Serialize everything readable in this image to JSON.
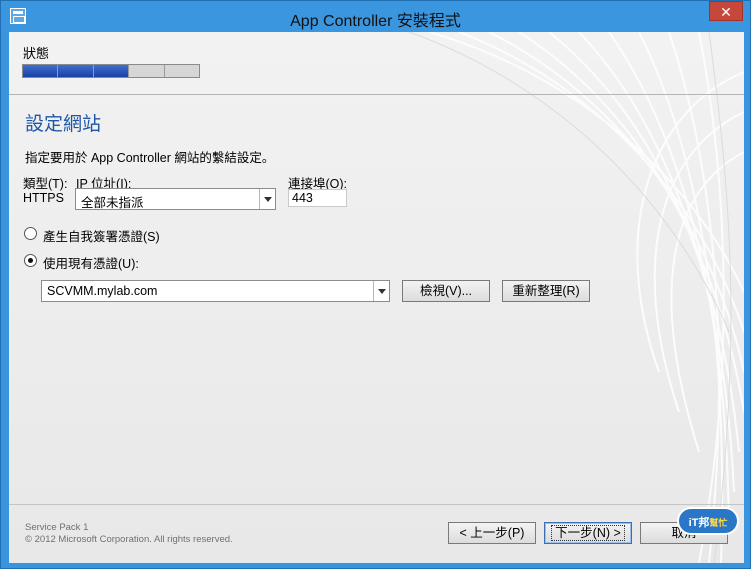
{
  "window": {
    "title": "App Controller 安裝程式",
    "close_symbol": "✕"
  },
  "progress": {
    "label": "狀態",
    "segments_total": 5,
    "segments_done": 3
  },
  "page": {
    "title": "設定網站",
    "description": "指定要用於 App Controller 網站的繫結設定。"
  },
  "binding": {
    "type_label": "類型(T):",
    "type_value": "HTTPS",
    "ip_label": "IP 位址(I):",
    "ip_value": "全部未指派",
    "port_label": "連接埠(O):",
    "port_value": "443"
  },
  "certificate": {
    "option_generate": "產生自我簽署憑證(S)",
    "option_existing": "使用現有憑證(U):",
    "selected_option": "existing",
    "cert_value": "SCVMM.mylab.com",
    "view_button": "檢視(V)...",
    "refresh_button": "重新整理(R)"
  },
  "footer": {
    "service_pack": "Service Pack 1",
    "copyright": "© 2012 Microsoft Corporation. All rights reserved.",
    "back_button": "< 上一步(P)",
    "next_button": "下一步(N) >",
    "cancel_button": "取消"
  },
  "watermark": {
    "brand": "iT邦",
    "sub": "幫忙"
  },
  "colors": {
    "title_bar": "#3a97df",
    "close_button": "#c7473a",
    "accent_title": "#1f57a8",
    "progress_done": "#1b3fa6"
  },
  "icons": [
    "app-window-icon",
    "close-icon",
    "dropdown-arrow-icon"
  ]
}
